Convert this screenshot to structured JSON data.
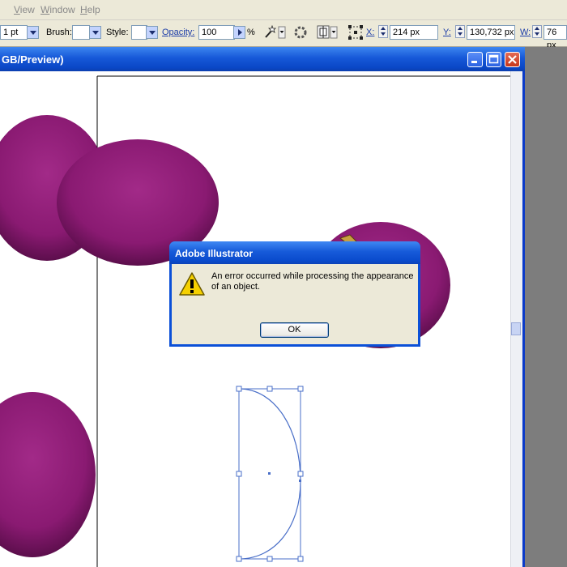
{
  "menubar": {
    "items": [
      {
        "label": "View",
        "underline": "V",
        "rest": "iew"
      },
      {
        "label": "Window",
        "underline": "W",
        "rest": "indow"
      },
      {
        "label": "Help",
        "underline": "H",
        "rest": "elp"
      }
    ]
  },
  "controlbar": {
    "stroke_weight": "1 pt",
    "brush_label": "Brush:",
    "style_label": "Style:",
    "opacity_label": "Opacity:",
    "opacity_value": "100",
    "percent": "%",
    "x_label": "X:",
    "x_value": "214 px",
    "y_label": "Y:",
    "y_value": "130,732 px",
    "w_label": "W:",
    "w_value": "76 px",
    "icons": [
      "magic-wand-icon",
      "recolor-icon",
      "align-icon",
      "transform-icon"
    ]
  },
  "document": {
    "title": "GB/Preview)",
    "window_buttons": [
      "minimize-icon",
      "maximize-icon",
      "close-icon"
    ],
    "shape_color": "#8e1a74"
  },
  "dialog": {
    "title": "Adobe Illustrator",
    "message": "An error occurred while processing the appearance of an object.",
    "ok_label": "OK",
    "icon": "warning-icon"
  },
  "colors": {
    "xp_blue": "#0a47c6",
    "dialog_face": "#ece9d8",
    "selection": "#4a6fc8"
  }
}
